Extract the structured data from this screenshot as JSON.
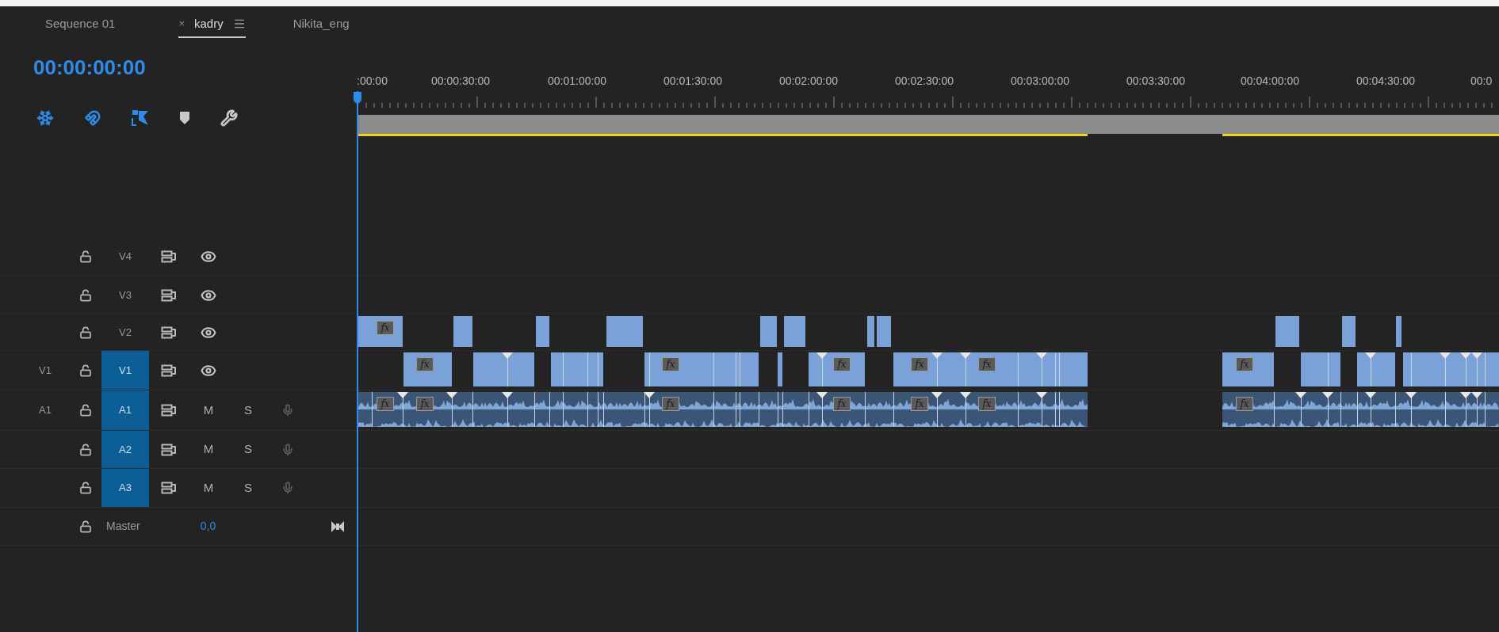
{
  "tabs": [
    {
      "label": "Sequence 01",
      "selected": false
    },
    {
      "label": "kadry",
      "selected": true,
      "close": "×"
    },
    {
      "label": "Nikita_eng",
      "selected": false
    }
  ],
  "timecode": "00:00:00:00",
  "ruler": {
    "labels": [
      ":00:00",
      "00:00:30:00",
      "00:01:00:00",
      "00:01:30:00",
      "00:02:00:00",
      "00:02:30:00",
      "00:03:00:00",
      "00:03:30:00",
      "00:04:00:00",
      "00:04:30:00",
      "00:0"
    ]
  },
  "tracks": [
    {
      "name": "V4",
      "kind": "video",
      "targeted": false
    },
    {
      "name": "V3",
      "kind": "video",
      "targeted": false
    },
    {
      "name": "V2",
      "kind": "video",
      "targeted": false,
      "badges": [
        "fx"
      ]
    },
    {
      "name": "V1",
      "kind": "video",
      "targeted": true,
      "source": "V1",
      "badges": [
        "fx",
        "fx",
        "fx",
        "fx",
        "fx",
        "fx"
      ]
    },
    {
      "name": "A1",
      "kind": "audio",
      "targeted": true,
      "source": "A1",
      "mute": "M",
      "solo": "S",
      "badges": [
        "fx",
        "fx",
        "fx",
        "fx",
        "fx",
        "fx",
        "fx"
      ]
    },
    {
      "name": "A2",
      "kind": "audio",
      "targeted": true,
      "mute": "M",
      "solo": "S"
    },
    {
      "name": "A3",
      "kind": "audio",
      "targeted": true,
      "mute": "M",
      "solo": "S"
    }
  ],
  "master": {
    "name": "Master",
    "value": "0,0"
  }
}
